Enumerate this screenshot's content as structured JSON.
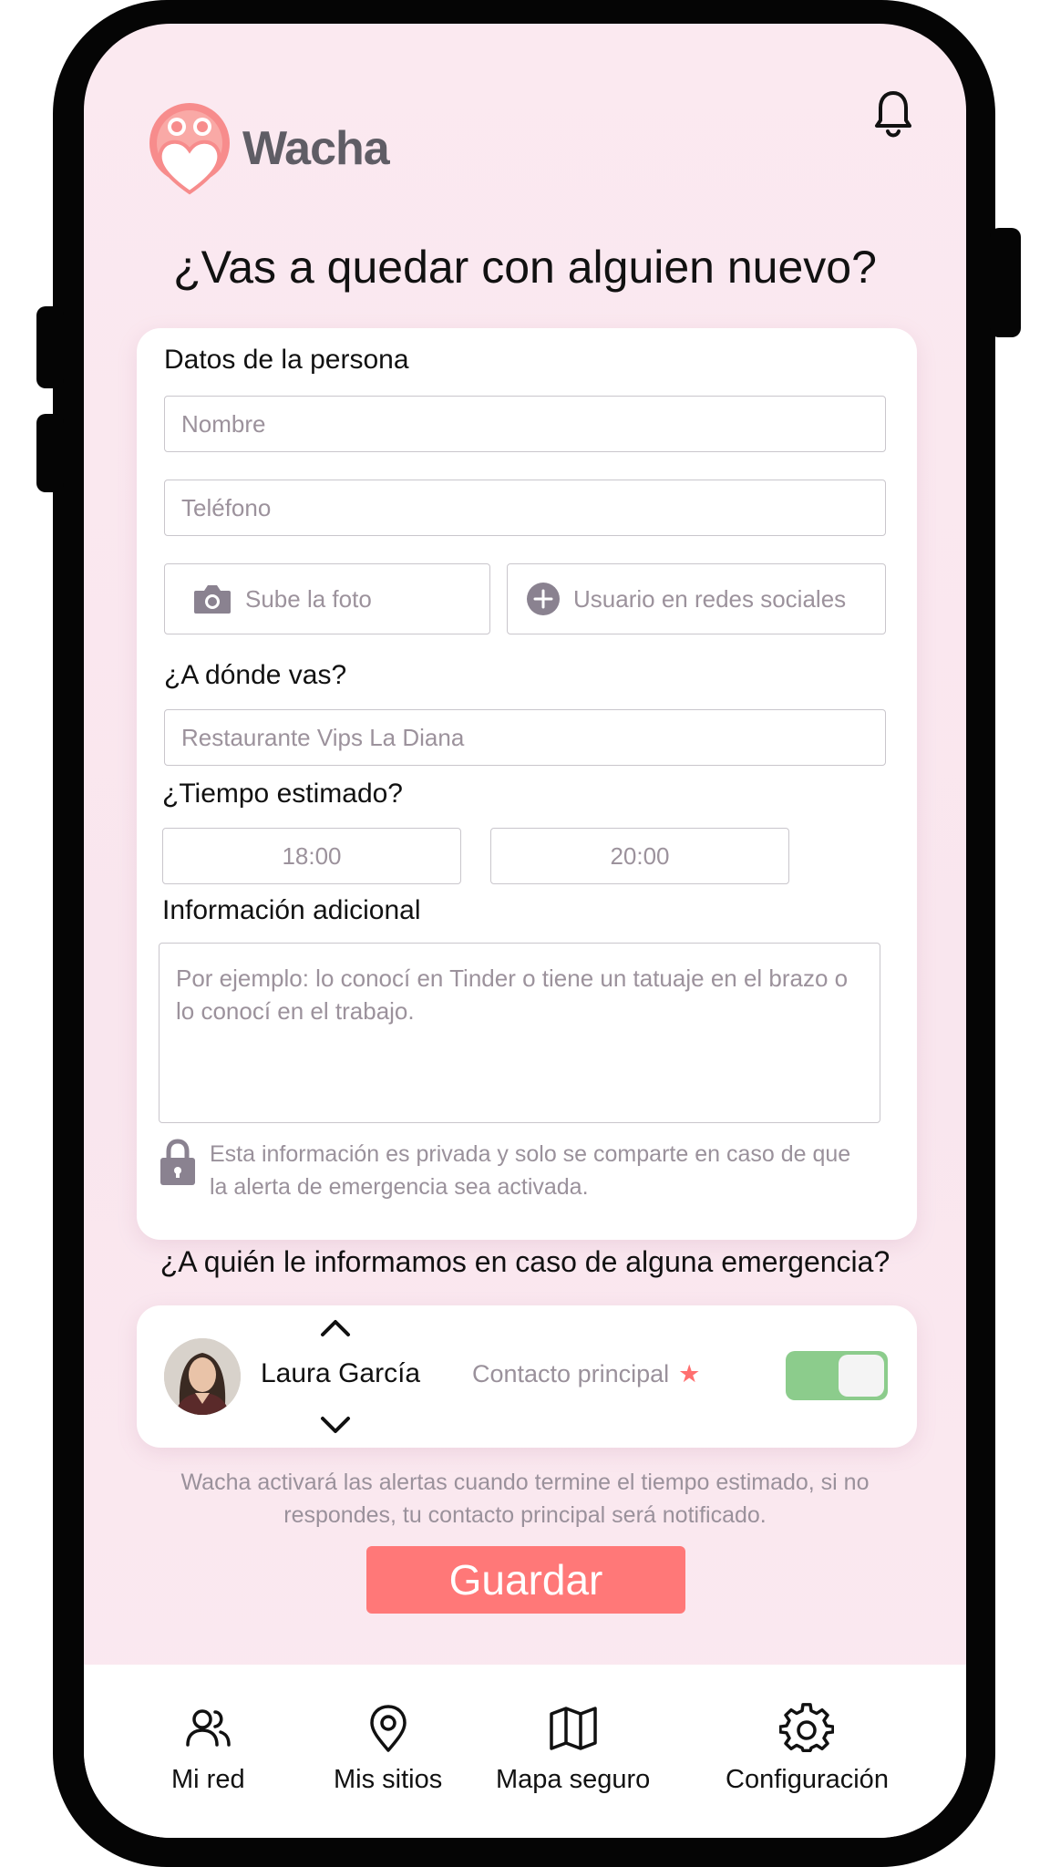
{
  "app": {
    "name": "Wacha"
  },
  "heading": "¿Vas a quedar con alguien nuevo?",
  "person_section": {
    "title": "Datos de la persona",
    "name_placeholder": "Nombre",
    "phone_placeholder": "Teléfono",
    "photo_label": "Sube la foto",
    "social_label": "Usuario en redes sociales"
  },
  "destination": {
    "question": "¿A dónde vas?",
    "placeholder": "Restaurante Vips La Diana"
  },
  "time": {
    "question": "¿Tiempo estimado?",
    "start": "18:00",
    "end": "20:00"
  },
  "additional": {
    "title": "Información adicional",
    "placeholder": "Por ejemplo: lo conocí en Tinder o tiene un tatuaje en el brazo o lo conocí en el trabajo.",
    "privacy_note": "Esta información es privada y solo se comparte en caso de que la alerta de emergencia sea activada."
  },
  "emergency": {
    "question": "¿A quién le informamos en caso de alguna emergencia?",
    "contact_name": "Laura García",
    "contact_role": "Contacto principal",
    "star": "★",
    "toggle_on": true
  },
  "note": "Wacha activará las alertas cuando termine el tiempo estimado, si no respondes, tu contacto principal será notificado.",
  "save_label": "Guardar",
  "nav": {
    "items": [
      {
        "label": "Mi red",
        "icon": "users-icon"
      },
      {
        "label": "Mis sitios",
        "icon": "map-pin-icon"
      },
      {
        "label": "Mapa seguro",
        "icon": "map-icon"
      },
      {
        "label": "Configuración",
        "icon": "gear-icon"
      }
    ]
  },
  "colors": {
    "background": "#fbe9f0",
    "accent": "#ff7878",
    "toggle_on": "#8ccc8c",
    "logo_text": "#5f5d65",
    "placeholder": "#9c929c"
  }
}
